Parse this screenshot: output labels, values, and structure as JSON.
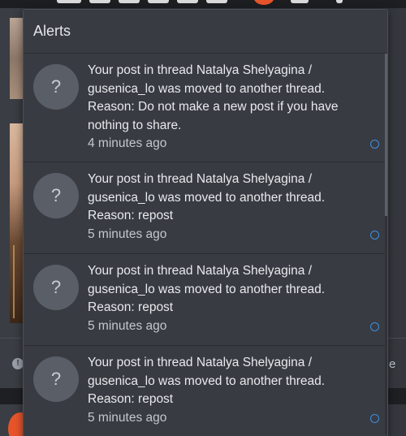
{
  "popup": {
    "title": "Alerts"
  },
  "alerts": [
    {
      "text_line1": "Your post in thread Natalya Shelyagina /",
      "text_line2": "gusenica_lo was moved to another thread.",
      "text_line3": "Reason: Do not make a new post if you have",
      "text_line4": "nothing to share.",
      "time": "4 minutes ago",
      "avatar_glyph": "?"
    },
    {
      "text_line1": "Your post in thread Natalya Shelyagina /",
      "text_line2": "gusenica_lo was moved to another thread.",
      "text_line3": "Reason: repost",
      "time": "5 minutes ago",
      "avatar_glyph": "?"
    },
    {
      "text_line1": "Your post in thread Natalya Shelyagina /",
      "text_line2": "gusenica_lo was moved to another thread.",
      "text_line3": "Reason: repost",
      "time": "5 minutes ago",
      "avatar_glyph": "?"
    },
    {
      "text_line1": "Your post in thread Natalya Shelyagina /",
      "text_line2": "gusenica_lo was moved to another thread.",
      "text_line3": "Reason: repost",
      "time": "5 minutes ago",
      "avatar_glyph": "?"
    }
  ],
  "background": {
    "right_edge_text": "e",
    "warning_glyph": "!"
  },
  "colors": {
    "popup_bg": "#383b42",
    "unread_marker": "#3d8fe0",
    "accent_orange": "#e8542a"
  },
  "icons": {
    "avatar": "question-mark-avatar-icon",
    "unread": "unread-circle-icon",
    "warning": "warning-icon"
  }
}
